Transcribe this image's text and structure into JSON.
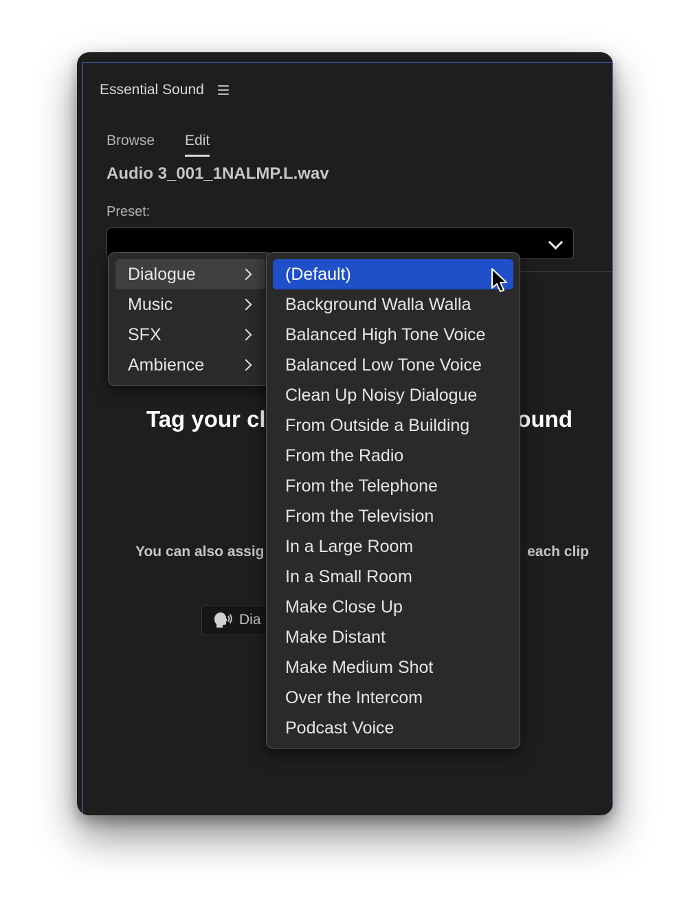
{
  "panel": {
    "title": "Essential Sound"
  },
  "tabs": [
    {
      "label": "Browse"
    },
    {
      "label": "Edit"
    }
  ],
  "clip": {
    "filename": "Audio 3_001_1NALMP.L.wav"
  },
  "preset": {
    "label": "Preset:",
    "value": ""
  },
  "background": {
    "heading_left": "Tag your cli",
    "heading_right": "ound",
    "assign_left": "You can also assig",
    "assign_right": "each clip",
    "chip_label": "Dia"
  },
  "category_menu": [
    {
      "label": "Dialogue"
    },
    {
      "label": "Music"
    },
    {
      "label": "SFX"
    },
    {
      "label": "Ambience"
    }
  ],
  "preset_menu": [
    {
      "label": "(Default)"
    },
    {
      "label": "Background Walla Walla"
    },
    {
      "label": "Balanced High Tone Voice"
    },
    {
      "label": "Balanced Low Tone Voice"
    },
    {
      "label": "Clean Up Noisy Dialogue"
    },
    {
      "label": "From Outside a Building"
    },
    {
      "label": "From the Radio"
    },
    {
      "label": "From the Telephone"
    },
    {
      "label": "From the Television"
    },
    {
      "label": "In a Large Room"
    },
    {
      "label": "In a Small Room"
    },
    {
      "label": "Make Close Up"
    },
    {
      "label": "Make Distant"
    },
    {
      "label": "Make Medium Shot"
    },
    {
      "label": "Over the Intercom"
    },
    {
      "label": "Podcast Voice"
    }
  ],
  "colors": {
    "accent": "#1f4fc9",
    "panel_bg": "#1e1e1e",
    "menu_bg": "#2a2a2a"
  }
}
